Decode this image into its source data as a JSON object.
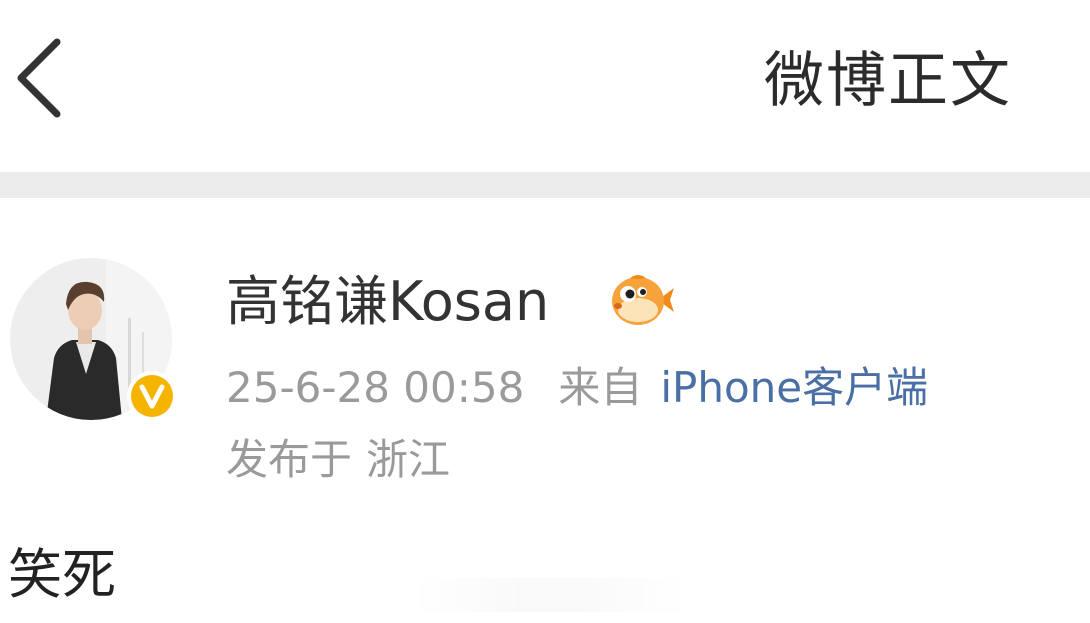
{
  "navbar": {
    "back_icon": "chevron-left-icon",
    "title": "微博正文"
  },
  "post": {
    "author": {
      "name": "高铭谦Kosan",
      "avatar_icon": "user-avatar",
      "verified_badge_icon": "verified-v-icon",
      "verified_badge_color": "#f5b400",
      "medal_icon": "pufferfish-icon"
    },
    "timestamp": "25-6-28 00:58",
    "source_prefix": "来自",
    "source_name": "iPhone客户端",
    "location_prefix": "发布于",
    "location": "浙江",
    "text": "笑死"
  },
  "colors": {
    "link": "#4a6fa5",
    "meta": "#9a9a9a",
    "divider": "#ececec",
    "title": "#2b2b2b"
  }
}
